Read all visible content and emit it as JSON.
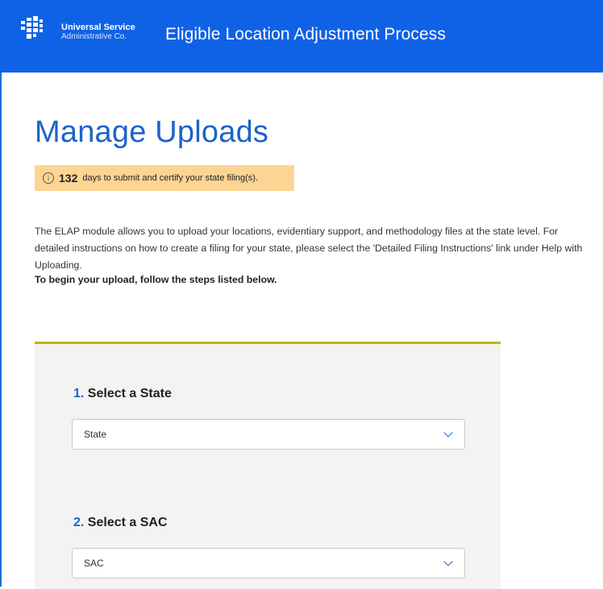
{
  "header": {
    "org_name_line1": "Universal Service",
    "org_name_line2": "Administrative Co.",
    "app_title": "Eligible Location Adjustment Process",
    "background_color": "#0f62e6"
  },
  "page": {
    "title": "Manage Uploads",
    "alert": {
      "icon": "info-icon",
      "days": "132",
      "text": "days to submit and certify your state filing(s).",
      "background_color": "#fcd594"
    },
    "intro": "The ELAP module allows you to upload your locations, evidentiary support, and methodology files at the state level. For detailed instructions on how to create a filing for your state, please select the 'Detailed Filing Instructions' link under Help with Uploading.",
    "instruction": "To begin your upload, follow the steps listed below."
  },
  "steps": [
    {
      "number": "1.",
      "title": "Select a State",
      "select_value": "State"
    },
    {
      "number": "2.",
      "title": "Select a SAC",
      "select_value": "SAC"
    }
  ],
  "colors": {
    "accent": "#1c63c9",
    "panel_rule": "#b8b51a"
  }
}
